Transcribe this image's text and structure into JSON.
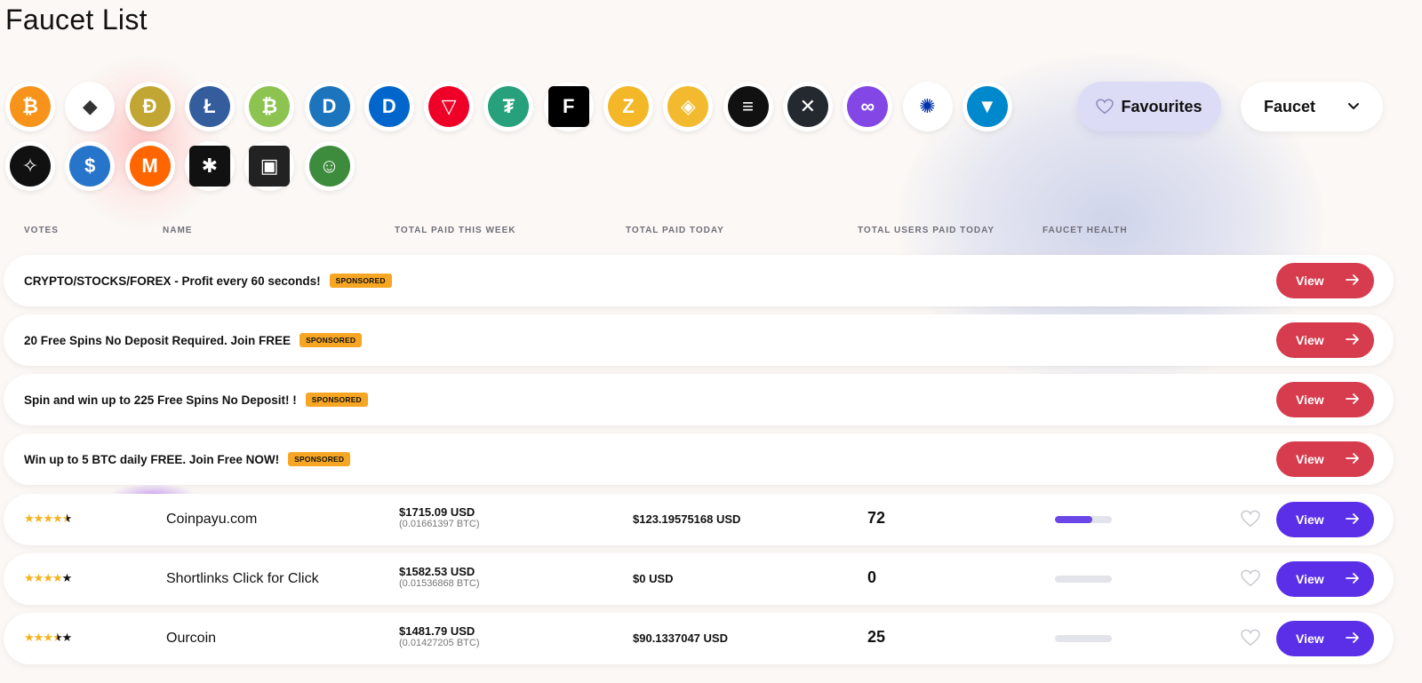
{
  "title": "Faucet List",
  "coins_row1": [
    {
      "name": "bitcoin",
      "color": "#f7931a",
      "glyph": "₿"
    },
    {
      "name": "ethereum",
      "color": "#ffffff",
      "glyph": "◆"
    },
    {
      "name": "dogecoin",
      "color": "#c2a633",
      "glyph": "Ð"
    },
    {
      "name": "litecoin",
      "color": "#345d9d",
      "glyph": "Ł"
    },
    {
      "name": "bitcoin-cash",
      "color": "#8dc351",
      "glyph": "₿"
    },
    {
      "name": "dash",
      "color": "#1c75bc",
      "glyph": "D"
    },
    {
      "name": "digibyte",
      "color": "#0066cc",
      "glyph": "D"
    },
    {
      "name": "tron",
      "color": "#ef0027",
      "glyph": "▽"
    },
    {
      "name": "tether",
      "color": "#26a17b",
      "glyph": "₮"
    },
    {
      "name": "feyorra",
      "color": "#000000",
      "glyph": "F"
    },
    {
      "name": "zcash",
      "color": "#f4b728",
      "glyph": "Z"
    },
    {
      "name": "binance",
      "color": "#f3ba2f",
      "glyph": "◈"
    },
    {
      "name": "solana",
      "color": "#111111",
      "glyph": "≡"
    },
    {
      "name": "xrp",
      "color": "#23292f",
      "glyph": "✕"
    },
    {
      "name": "polygon",
      "color": "#8247e5",
      "glyph": "∞"
    },
    {
      "name": "cardano",
      "color": "#ffffff",
      "glyph": "✺"
    },
    {
      "name": "toncoin",
      "color": "#0088cc",
      "glyph": "▼"
    }
  ],
  "coins_row2": [
    {
      "name": "stellar",
      "color": "#111111",
      "glyph": "✧"
    },
    {
      "name": "usdc",
      "color": "#2775ca",
      "glyph": "$"
    },
    {
      "name": "monero",
      "color": "#ff6600",
      "glyph": "M"
    },
    {
      "name": "coin-up-arrow",
      "color": "#111111",
      "glyph": "✱"
    },
    {
      "name": "coin-card",
      "color": "#222222",
      "glyph": "▣"
    },
    {
      "name": "pepe",
      "color": "#3d8b3d",
      "glyph": "☺"
    }
  ],
  "favourites_label": "Favourites",
  "select_value": "Faucet",
  "headers": {
    "votes": "VOTES",
    "name": "NAME",
    "week": "TOTAL PAID THIS WEEK",
    "today": "TOTAL PAID TODAY",
    "users": "TOTAL USERS PAID TODAY",
    "health": "FAUCET HEALTH"
  },
  "sponsored": [
    {
      "title": "CRYPTO/STOCKS/FOREX - Profit every 60 seconds!",
      "badge": "SPONSORED",
      "button": "View"
    },
    {
      "title": "20 Free Spins No Deposit Required. Join FREE",
      "badge": "SPONSORED",
      "button": "View"
    },
    {
      "title": "Spin and win up to 225 Free Spins No Deposit! !",
      "badge": "SPONSORED",
      "button": "View"
    },
    {
      "title": "Win up to 5 BTC daily FREE. Join Free NOW!",
      "badge": "SPONSORED",
      "button": "View"
    }
  ],
  "faucets": [
    {
      "rating": 4.5,
      "name": "Coinpayu.com",
      "week_usd": "$1715.09 USD",
      "week_btc": "(0.01661397 BTC)",
      "today": "$123.19575168 USD",
      "users": "72",
      "health": 0.65,
      "button": "View"
    },
    {
      "rating": 4,
      "name": "Shortlinks Click for Click",
      "week_usd": "$1582.53 USD",
      "week_btc": "(0.01536868 BTC)",
      "today": "$0 USD",
      "users": "0",
      "health": 0,
      "button": "View"
    },
    {
      "rating": 3.5,
      "name": "Ourcoin",
      "week_usd": "$1481.79 USD",
      "week_btc": "(0.01427205 BTC)",
      "today": "$90.1337047 USD",
      "users": "25",
      "health": 0,
      "button": "View"
    }
  ]
}
